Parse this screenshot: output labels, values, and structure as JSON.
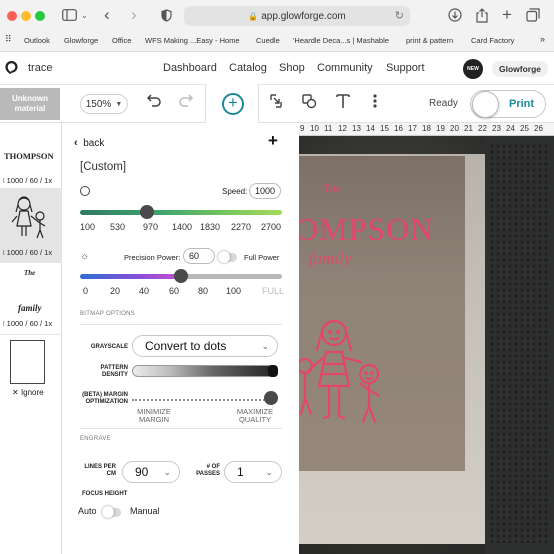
{
  "browser": {
    "url": "app.glowforge.com",
    "bookmarks": [
      "Outlook",
      "Glowforge",
      "Office",
      "WFS Making ...Easy - Home",
      "Cuedle",
      "'Heardle Deca...s | Mashable",
      "print & pattern",
      "Card Factory"
    ]
  },
  "app": {
    "title": "trace",
    "nav": [
      "Dashboard",
      "Catalog",
      "Shop",
      "Community",
      "Support"
    ],
    "new_badge": "NEW",
    "account": "Glowforge"
  },
  "toolbar": {
    "material": "Unknown material",
    "zoom": "150%",
    "status": "Ready",
    "print": "Print"
  },
  "thumbs": [
    {
      "title": "THOMPSON",
      "meta": "1000 / 60 / 1x"
    },
    {
      "title": "",
      "meta": "1000 / 60 / 1x"
    },
    {
      "title": "The family",
      "title_top": "The",
      "title_bottom": "family",
      "meta": "1000 / 60 / 1x"
    },
    {
      "title": "",
      "meta": "Ignore"
    }
  ],
  "panel": {
    "back": "back",
    "name": "[Custom]",
    "speed_label": "Speed:",
    "speed_value": "1000",
    "speed_ticks": [
      "100",
      "530",
      "970",
      "1400",
      "1830",
      "2270",
      "2700"
    ],
    "speed_slider": 0.33,
    "precision_label": "Precision Power:",
    "precision_value": "60",
    "full_power_label": "Full Power",
    "power_ticks": [
      "0",
      "20",
      "40",
      "60",
      "80",
      "100",
      "FULL"
    ],
    "power_slider": 0.5,
    "bitmap_section": "BITMAP OPTIONS",
    "grayscale_label": "GRAYSCALE",
    "grayscale_value": "Convert to dots",
    "density_label": "PATTERN DENSITY",
    "optimization_label": "(BETA) MARGIN OPTIMIZATION",
    "min_label": "MINIMIZE MARGIN",
    "max_label": "MAXIMIZE QUALITY",
    "engrave_section": "ENGRAVE",
    "lines_label": "LINES PER CM",
    "lines_value": "90",
    "passes_label": "# OF PASSES",
    "passes_value": "1",
    "focus_label": "FOCUS HEIGHT",
    "focus_auto": "Auto",
    "focus_manual": "Manual"
  },
  "canvas": {
    "ruler": [
      "9",
      "10",
      "11",
      "12",
      "13",
      "14",
      "15",
      "16",
      "17",
      "18",
      "19",
      "20",
      "21",
      "22",
      "23",
      "24",
      "25",
      "26"
    ],
    "text_the": "The",
    "text_name": "OMPSON",
    "text_family": "family",
    "accent_color": "#e2476b"
  },
  "colors": {
    "teal": "#1a8a9a",
    "speed_gradient": [
      "#2f7a63",
      "#3fa56d",
      "#7ac85e",
      "#a6d95a"
    ],
    "power_gradient": [
      "#2f6fd0",
      "#8c4fd6",
      "#c64fd1",
      "#b9b9b9"
    ]
  }
}
